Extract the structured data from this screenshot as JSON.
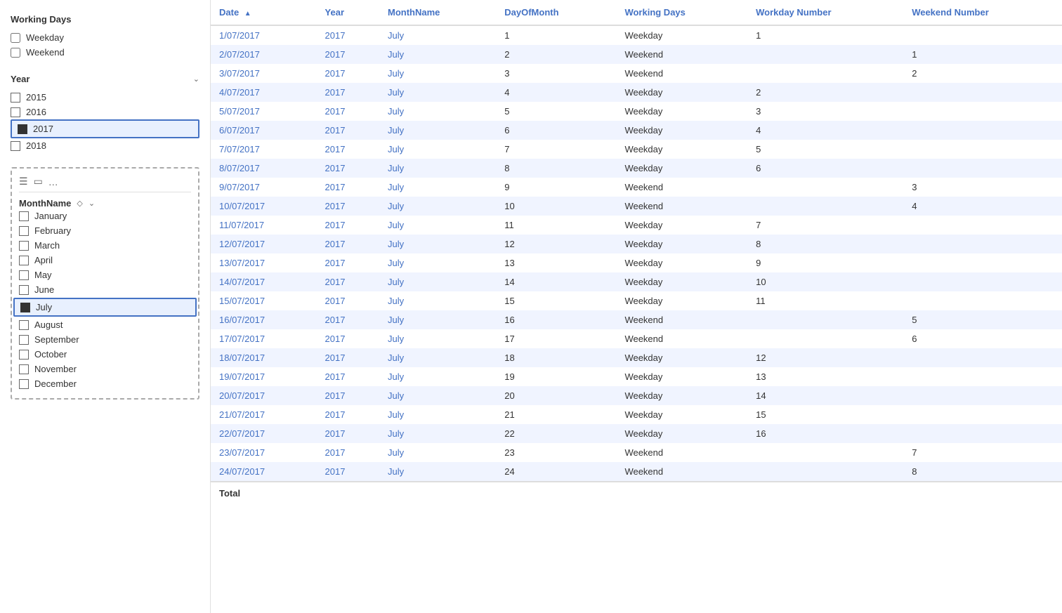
{
  "leftPanel": {
    "workingDays": {
      "title": "Working Days",
      "options": [
        {
          "label": "Weekday",
          "checked": false
        },
        {
          "label": "Weekend",
          "checked": false
        }
      ]
    },
    "year": {
      "title": "Year",
      "items": [
        {
          "value": "2015",
          "selected": false
        },
        {
          "value": "2016",
          "selected": false
        },
        {
          "value": "2017",
          "selected": true
        },
        {
          "value": "2018",
          "selected": false
        }
      ]
    },
    "monthCard": {
      "headerLabel": "MonthName",
      "months": [
        {
          "label": "January",
          "selected": false
        },
        {
          "label": "February",
          "selected": false
        },
        {
          "label": "March",
          "selected": false
        },
        {
          "label": "April",
          "selected": false
        },
        {
          "label": "May",
          "selected": false
        },
        {
          "label": "June",
          "selected": false
        },
        {
          "label": "July",
          "selected": true
        },
        {
          "label": "August",
          "selected": false
        },
        {
          "label": "September",
          "selected": false
        },
        {
          "label": "October",
          "selected": false
        },
        {
          "label": "November",
          "selected": false
        },
        {
          "label": "December",
          "selected": false
        }
      ]
    }
  },
  "table": {
    "columns": [
      "Date",
      "Year",
      "MonthName",
      "DayOfMonth",
      "Working Days",
      "Workday Number",
      "Weekend Number"
    ],
    "rows": [
      {
        "date": "1/07/2017",
        "year": "2017",
        "month": "July",
        "day": 1,
        "workingDay": "Weekday",
        "workdayNum": 1,
        "weekendNum": ""
      },
      {
        "date": "2/07/2017",
        "year": "2017",
        "month": "July",
        "day": 2,
        "workingDay": "Weekend",
        "workdayNum": "",
        "weekendNum": 1
      },
      {
        "date": "3/07/2017",
        "year": "2017",
        "month": "July",
        "day": 3,
        "workingDay": "Weekend",
        "workdayNum": "",
        "weekendNum": 2
      },
      {
        "date": "4/07/2017",
        "year": "2017",
        "month": "July",
        "day": 4,
        "workingDay": "Weekday",
        "workdayNum": 2,
        "weekendNum": ""
      },
      {
        "date": "5/07/2017",
        "year": "2017",
        "month": "July",
        "day": 5,
        "workingDay": "Weekday",
        "workdayNum": 3,
        "weekendNum": ""
      },
      {
        "date": "6/07/2017",
        "year": "2017",
        "month": "July",
        "day": 6,
        "workingDay": "Weekday",
        "workdayNum": 4,
        "weekendNum": ""
      },
      {
        "date": "7/07/2017",
        "year": "2017",
        "month": "July",
        "day": 7,
        "workingDay": "Weekday",
        "workdayNum": 5,
        "weekendNum": ""
      },
      {
        "date": "8/07/2017",
        "year": "2017",
        "month": "July",
        "day": 8,
        "workingDay": "Weekday",
        "workdayNum": 6,
        "weekendNum": ""
      },
      {
        "date": "9/07/2017",
        "year": "2017",
        "month": "July",
        "day": 9,
        "workingDay": "Weekend",
        "workdayNum": "",
        "weekendNum": 3
      },
      {
        "date": "10/07/2017",
        "year": "2017",
        "month": "July",
        "day": 10,
        "workingDay": "Weekend",
        "workdayNum": "",
        "weekendNum": 4
      },
      {
        "date": "11/07/2017",
        "year": "2017",
        "month": "July",
        "day": 11,
        "workingDay": "Weekday",
        "workdayNum": 7,
        "weekendNum": ""
      },
      {
        "date": "12/07/2017",
        "year": "2017",
        "month": "July",
        "day": 12,
        "workingDay": "Weekday",
        "workdayNum": 8,
        "weekendNum": ""
      },
      {
        "date": "13/07/2017",
        "year": "2017",
        "month": "July",
        "day": 13,
        "workingDay": "Weekday",
        "workdayNum": 9,
        "weekendNum": ""
      },
      {
        "date": "14/07/2017",
        "year": "2017",
        "month": "July",
        "day": 14,
        "workingDay": "Weekday",
        "workdayNum": 10,
        "weekendNum": ""
      },
      {
        "date": "15/07/2017",
        "year": "2017",
        "month": "July",
        "day": 15,
        "workingDay": "Weekday",
        "workdayNum": 11,
        "weekendNum": ""
      },
      {
        "date": "16/07/2017",
        "year": "2017",
        "month": "July",
        "day": 16,
        "workingDay": "Weekend",
        "workdayNum": "",
        "weekendNum": 5
      },
      {
        "date": "17/07/2017",
        "year": "2017",
        "month": "July",
        "day": 17,
        "workingDay": "Weekend",
        "workdayNum": "",
        "weekendNum": 6
      },
      {
        "date": "18/07/2017",
        "year": "2017",
        "month": "July",
        "day": 18,
        "workingDay": "Weekday",
        "workdayNum": 12,
        "weekendNum": ""
      },
      {
        "date": "19/07/2017",
        "year": "2017",
        "month": "July",
        "day": 19,
        "workingDay": "Weekday",
        "workdayNum": 13,
        "weekendNum": ""
      },
      {
        "date": "20/07/2017",
        "year": "2017",
        "month": "July",
        "day": 20,
        "workingDay": "Weekday",
        "workdayNum": 14,
        "weekendNum": ""
      },
      {
        "date": "21/07/2017",
        "year": "2017",
        "month": "July",
        "day": 21,
        "workingDay": "Weekday",
        "workdayNum": 15,
        "weekendNum": ""
      },
      {
        "date": "22/07/2017",
        "year": "2017",
        "month": "July",
        "day": 22,
        "workingDay": "Weekday",
        "workdayNum": 16,
        "weekendNum": ""
      },
      {
        "date": "23/07/2017",
        "year": "2017",
        "month": "July",
        "day": 23,
        "workingDay": "Weekend",
        "workdayNum": "",
        "weekendNum": 7
      },
      {
        "date": "24/07/2017",
        "year": "2017",
        "month": "July",
        "day": 24,
        "workingDay": "Weekend",
        "workdayNum": "",
        "weekendNum": 8
      }
    ],
    "footer": "Total"
  }
}
